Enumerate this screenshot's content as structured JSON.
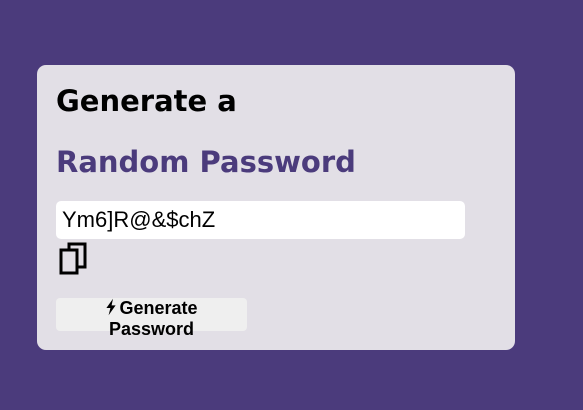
{
  "card": {
    "title_line_1": "Generate a",
    "title_line_2": "Random Password"
  },
  "password_field": {
    "value": "Ym6]R@&$chZ"
  },
  "copy_button": {
    "icon": "copy-icon"
  },
  "generate_button": {
    "icon": "bolt-icon",
    "label_line_1": "Generate",
    "label_line_2": "Password"
  },
  "colors": {
    "background": "#4b3b7c",
    "card": "#e2dfe6",
    "accent": "#4b3b7c",
    "button": "#efefef"
  }
}
